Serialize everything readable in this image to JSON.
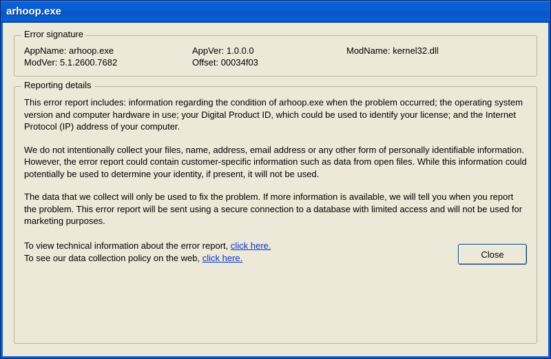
{
  "window": {
    "title": "arhoop.exe"
  },
  "error_signature": {
    "legend": "Error signature",
    "app_name_label": "AppName:",
    "app_name_value": "arhoop.exe",
    "app_ver_label": "AppVer:",
    "app_ver_value": "1.0.0.0",
    "mod_name_label": "ModName:",
    "mod_name_value": "kernel32.dll",
    "mod_ver_label": "ModVer:",
    "mod_ver_value": "5.1.2600.7682",
    "offset_label": "Offset:",
    "offset_value": "00034f03"
  },
  "reporting": {
    "legend": "Reporting details",
    "p1": "This error report includes: information regarding the condition of arhoop.exe when the problem occurred; the operating system version and computer hardware in use; your Digital Product ID, which could be used to identify your license; and the Internet Protocol (IP) address of your computer.",
    "p2": "We do not intentionally collect your files, name, address, email address or any other form of personally identifiable information. However, the error report could contain customer-specific information such as data from open files. While this information could potentially be used to determine your identity, if present, it will not be used.",
    "p3": "The data that we collect will only be used to fix the problem. If more information is available, we will tell you when you report the problem. This error report will be sent using a secure connection to a database with limited access and will not be used for marketing purposes.",
    "tech_line_prefix": "To view technical information about the error report, ",
    "policy_line_prefix": "To see our data collection policy on the web, ",
    "link_text": "click here."
  },
  "buttons": {
    "close": "Close"
  }
}
